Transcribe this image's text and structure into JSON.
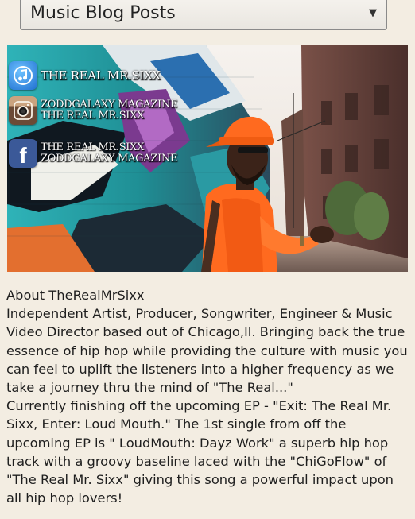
{
  "dropdown": {
    "selected": "Music Blog Posts"
  },
  "hero": {
    "social": [
      {
        "icon": "itunes-icon",
        "lines": [
          "THE REAL MR.SIXX"
        ]
      },
      {
        "icon": "instagram-icon",
        "lines": [
          "ZODDGALAXY MAGAZINE",
          "THE REAL MR.SIXX"
        ]
      },
      {
        "icon": "facebook-icon",
        "lines": [
          "THE REAL MR.SIXX",
          "ZODDGALAXY MAGAZINE"
        ]
      }
    ]
  },
  "article": {
    "heading": "About TheRealMrSixx",
    "paragraph1": "Independent Artist, Producer, Songwriter, Engineer & Music Video Director based out of Chicago,Il. Bringing back the true essence of hip hop while providing the culture with music you can feel to uplift the listeners into a higher frequency as we take a journey thru the mind of \"The Real...\"",
    "paragraph2": "Currently finishing off the upcoming EP - \"Exit: The Real Mr. Sixx, Enter: Loud Mouth.\" The 1st single from off the upcoming EP is \" LoudMouth: Dayz Work\" a superb hip hop track with a groovy baseline laced with the \"ChiGoFlow\" of \"The Real Mr. Sixx\" giving this song a powerful impact upon all hip hop lovers!"
  },
  "colors": {
    "background": "#f3ede2",
    "jacket": "#ff6a1f",
    "itunes": "#2f86d9",
    "facebook": "#3b5998"
  }
}
